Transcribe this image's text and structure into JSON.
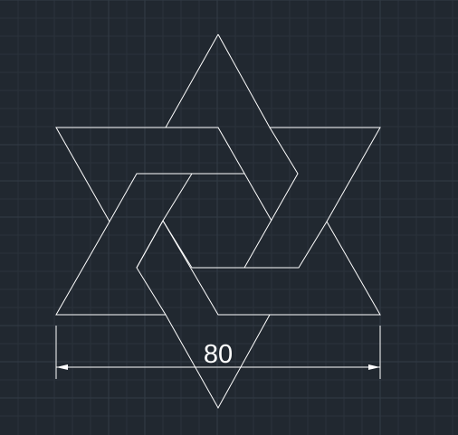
{
  "drawing": {
    "dimension_value": "80"
  },
  "colors": {
    "background": "#212830",
    "grid_minor": "#2a323b",
    "grid_major": "#333c46",
    "geometry": "#ffffff"
  }
}
